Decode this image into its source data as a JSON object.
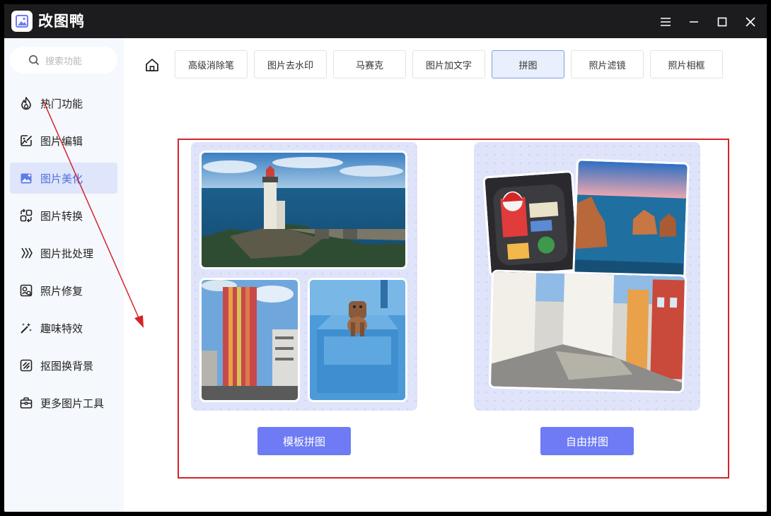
{
  "app": {
    "title": "改图鸭"
  },
  "window": {
    "menu_icon": "hamburger-menu-icon",
    "minimize_icon": "minimize-icon",
    "maximize_icon": "maximize-icon",
    "close_icon": "close-icon"
  },
  "sidebar": {
    "search_placeholder": "搜索功能",
    "items": [
      {
        "label": "热门功能",
        "icon": "flame-icon"
      },
      {
        "label": "图片编辑",
        "icon": "image-edit-icon"
      },
      {
        "label": "图片美化",
        "icon": "image-beautify-icon",
        "active": true
      },
      {
        "label": "图片转换",
        "icon": "convert-icon"
      },
      {
        "label": "图片批处理",
        "icon": "batch-icon"
      },
      {
        "label": "照片修复",
        "icon": "photo-repair-icon"
      },
      {
        "label": "趣味特效",
        "icon": "magic-wand-icon"
      },
      {
        "label": "抠图换背景",
        "icon": "cutout-icon"
      },
      {
        "label": "更多图片工具",
        "icon": "toolbox-icon"
      }
    ]
  },
  "tabs": [
    {
      "label": "高级消除笔"
    },
    {
      "label": "图片去水印"
    },
    {
      "label": "马赛克"
    },
    {
      "label": "图片加文字"
    },
    {
      "label": "拼图",
      "active": true
    },
    {
      "label": "照片滤镜"
    },
    {
      "label": "照片相框"
    }
  ],
  "options": {
    "template_collage_label": "模板拼图",
    "free_collage_label": "自由拼图"
  },
  "colors": {
    "accent": "#6e7bf4",
    "highlight_box": "#d3232b",
    "active_nav": "#dfe6fb",
    "titlebar": "#1c1c1e"
  }
}
